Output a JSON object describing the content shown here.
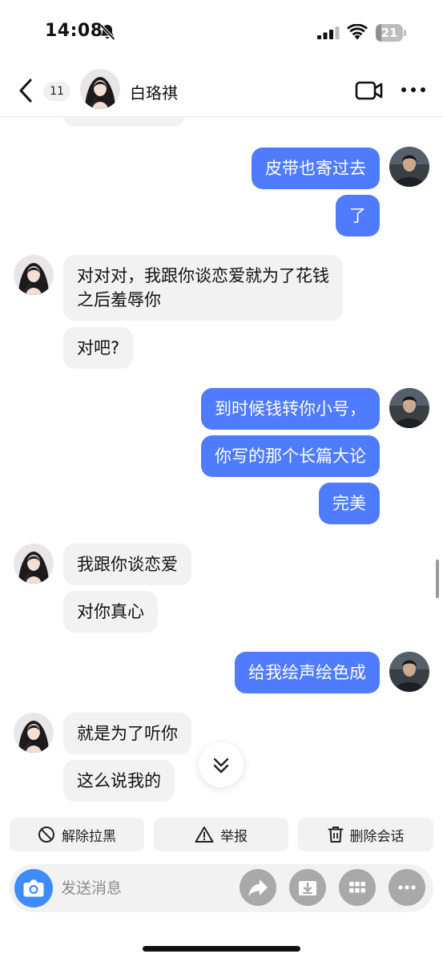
{
  "status_bar": {
    "time": "14:08",
    "battery": "21",
    "battery_fraction": 0.21
  },
  "header": {
    "unread_count": "11",
    "contact_name": "白珞祺"
  },
  "messages": [
    {
      "direction": "out",
      "text": "皮带也寄过去"
    },
    {
      "direction": "out",
      "text": "了"
    },
    {
      "direction": "in",
      "text_line1": "对对对，我跟你谈恋爱就为了花钱",
      "text_line2": "之后羞辱你"
    },
    {
      "direction": "in",
      "text": "对吧?"
    },
    {
      "direction": "out",
      "text": "到时候钱转你小号，"
    },
    {
      "direction": "out",
      "text": "你写的那个长篇大论"
    },
    {
      "direction": "out",
      "text": "完美"
    },
    {
      "direction": "in",
      "text": "我跟你谈恋爱"
    },
    {
      "direction": "in",
      "text": "对你真心"
    },
    {
      "direction": "out",
      "text": "给我绘声绘色成"
    },
    {
      "direction": "in",
      "text": "就是为了听你"
    },
    {
      "direction": "in",
      "text": "这么说我的"
    }
  ],
  "actions": {
    "unblock": "解除拉黑",
    "report": "举报",
    "delete_chat": "删除会话"
  },
  "input": {
    "placeholder": "发送消息"
  },
  "colors": {
    "outgoing_bubble": "#4f7bff",
    "incoming_bubble": "#f2f2f2",
    "camera_button": "#3d8bff"
  },
  "icons": [
    "chevron-left-icon",
    "video-camera-icon",
    "more-icon",
    "camera-icon",
    "share-icon",
    "download-icon",
    "grid-icon",
    "ellipsis-icon",
    "chevron-double-down-icon",
    "block-icon",
    "warning-icon",
    "trash-icon",
    "mute-bell-icon",
    "signal-icon",
    "wifi-icon"
  ]
}
